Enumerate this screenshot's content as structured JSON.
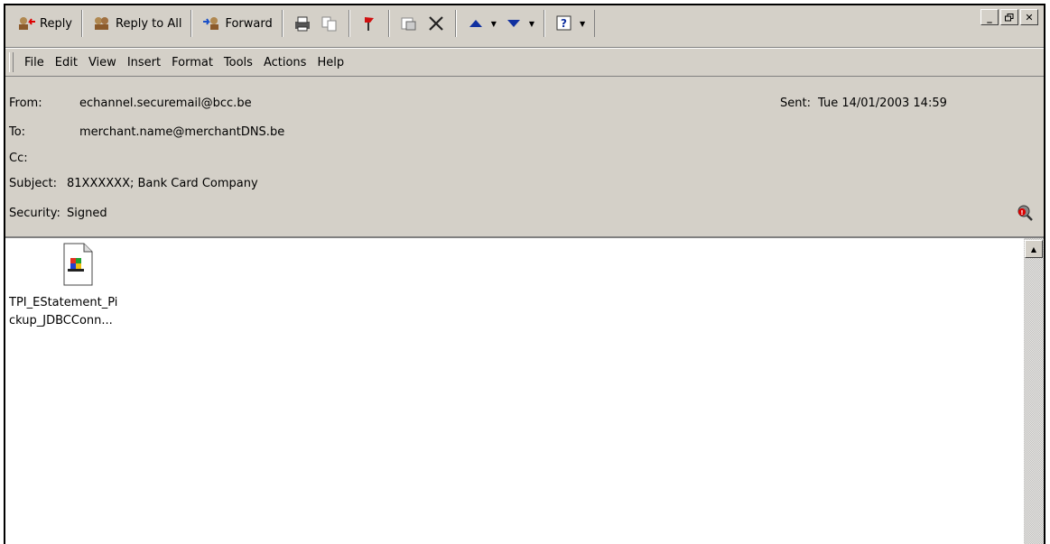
{
  "toolbar": {
    "reply": "Reply",
    "reply_all": "Reply to All",
    "forward": "Forward",
    "icons": [
      "reply-icon",
      "reply-all-icon",
      "forward-icon",
      "print-icon",
      "copy-icon",
      "flag-icon",
      "move-icon",
      "delete-icon",
      "previous-icon",
      "next-icon",
      "help-icon"
    ]
  },
  "window": {
    "minimize": "_",
    "restore": "🗗",
    "close": "✕"
  },
  "menu": [
    "File",
    "Edit",
    "View",
    "Insert",
    "Format",
    "Tools",
    "Actions",
    "Help"
  ],
  "header": {
    "from_label": "From:",
    "from_value": "echannel.securemail@bcc.be",
    "sent_label": "Sent:",
    "sent_value": "Tue 14/01/2003 14:59",
    "to_label": "To:",
    "to_value": "merchant.name@merchantDNS.be",
    "cc_label": "Cc:",
    "cc_value": "",
    "subject_label": "Subject:",
    "subject_value": "81XXXXXX; Bank Card Company",
    "security_label": "Security:",
    "security_value": "Signed"
  },
  "attachment": {
    "name_line1": "TPI_EStatement_Pi",
    "name_line2": "ckup_JDBCConn..."
  }
}
